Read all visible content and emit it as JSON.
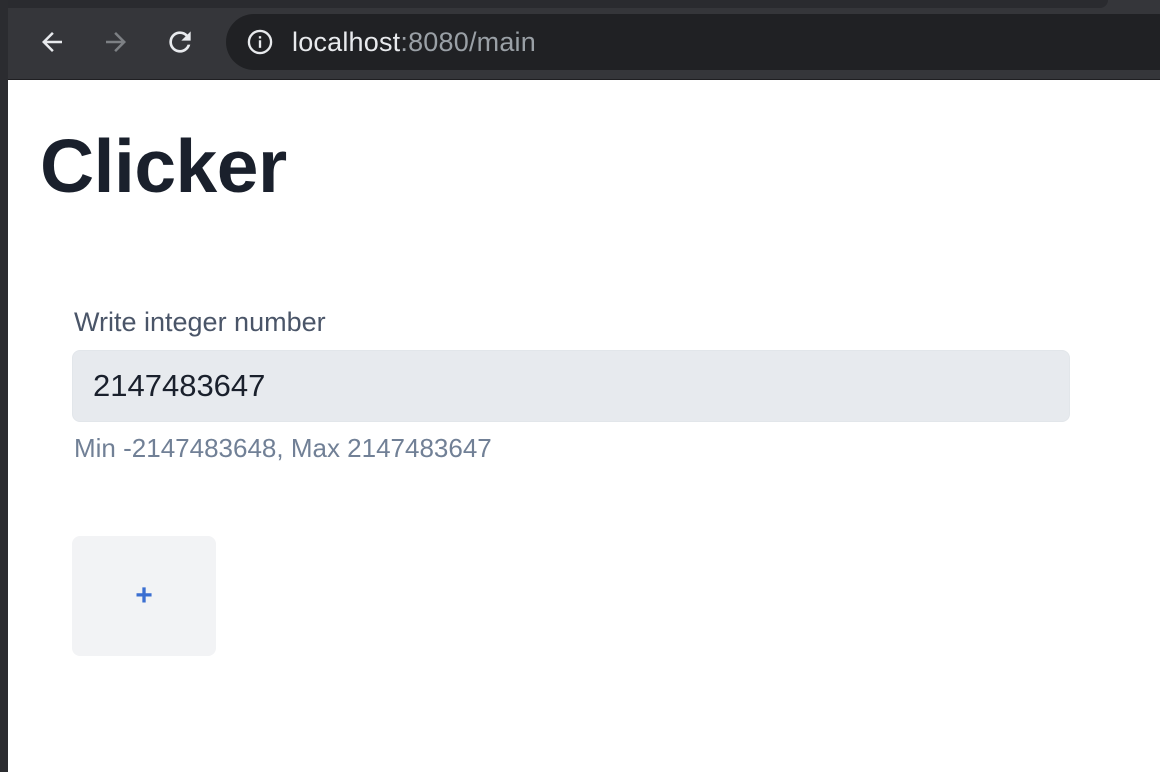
{
  "browser": {
    "url_host": "localhost",
    "url_rest": ":8080/main",
    "icons": {
      "back": "arrow-left-icon",
      "forward": "arrow-right-icon",
      "reload": "reload-icon",
      "site_info": "info-icon"
    },
    "forward_enabled": false
  },
  "page": {
    "title": "Clicker",
    "field_label": "Write integer number",
    "input_value": "2147483647",
    "helper_text": "Min -2147483648, Max 2147483647",
    "plus_button_label": "+"
  },
  "colors": {
    "title": "#1a202c",
    "input_background": "#e7eaee",
    "button_background": "#f2f3f5",
    "button_text": "#3b6fd1",
    "toolbar": "#35363a",
    "omnibox": "#202124"
  }
}
